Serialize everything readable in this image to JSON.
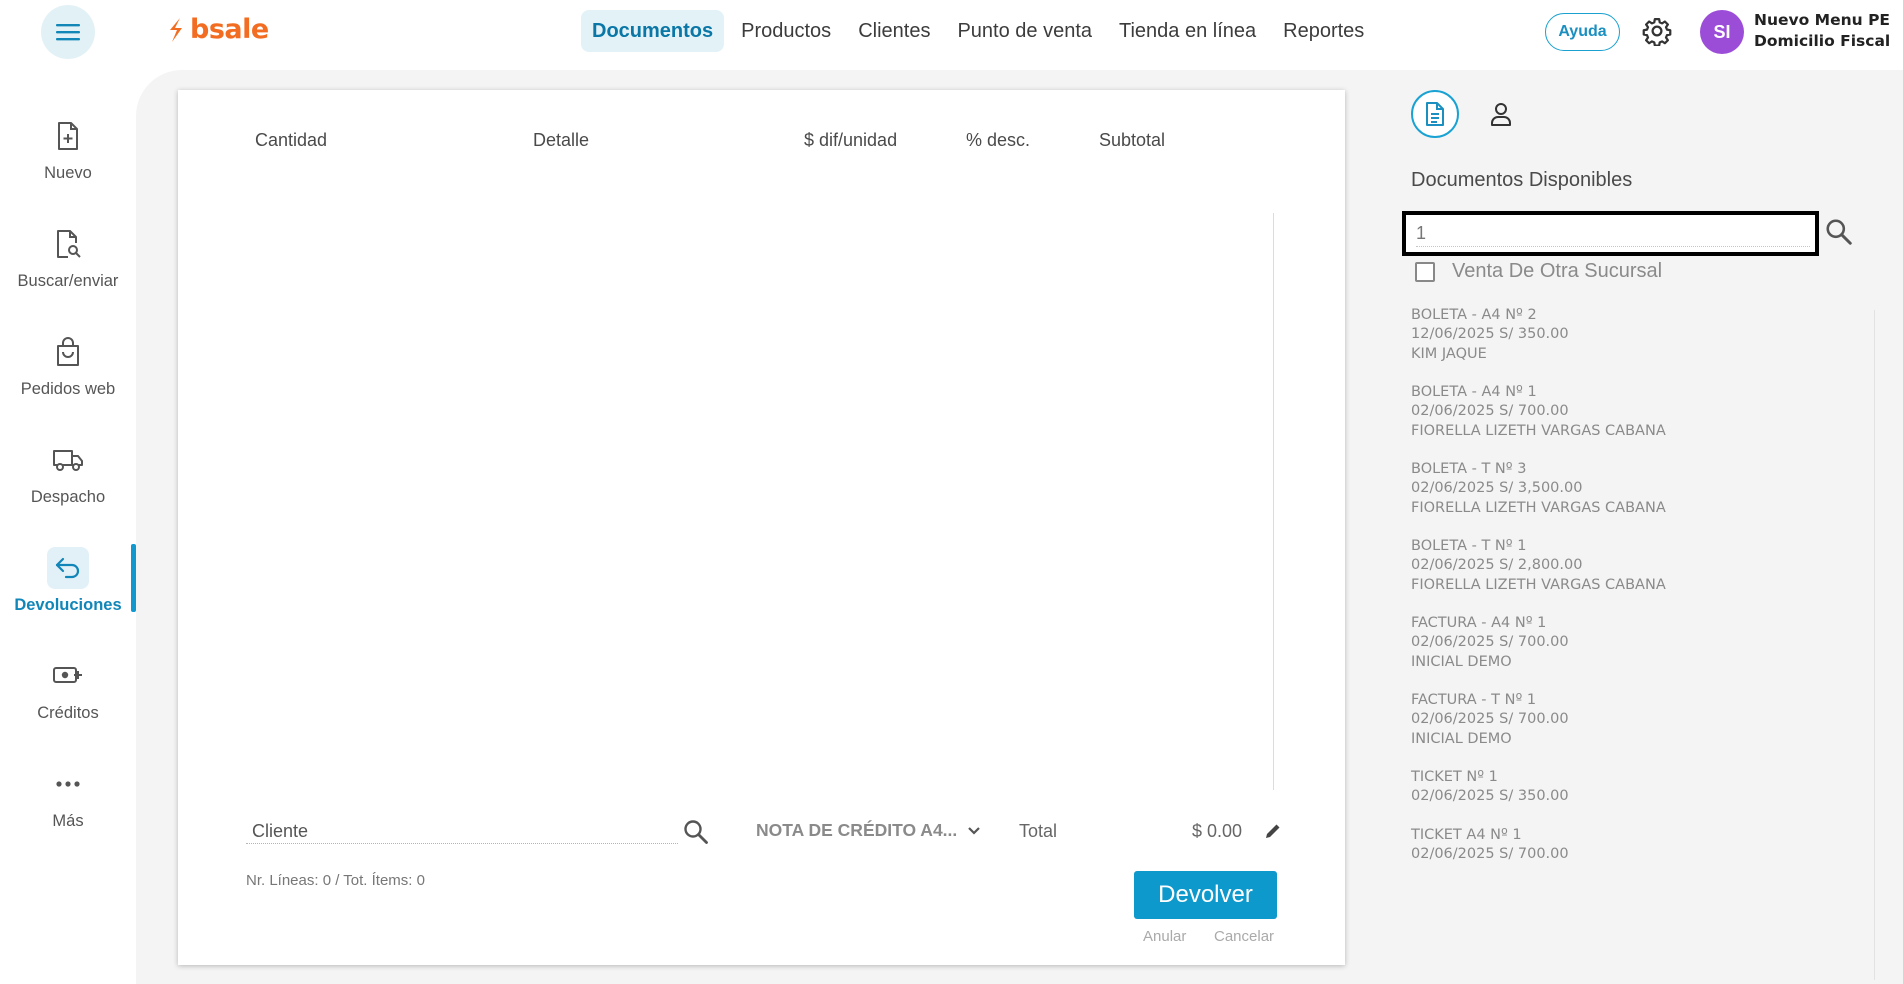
{
  "header": {
    "logo_text": "bsale",
    "nav": [
      {
        "label": "Documentos",
        "active": true
      },
      {
        "label": "Productos"
      },
      {
        "label": "Clientes"
      },
      {
        "label": "Punto de venta"
      },
      {
        "label": "Tienda en línea"
      },
      {
        "label": "Reportes"
      }
    ],
    "help_label": "Ayuda",
    "avatar_initials": "SI",
    "user_line1": "Nuevo Menu PE",
    "user_line2": "Domicilio Fiscal"
  },
  "sidebar": {
    "items": [
      {
        "label": "Nuevo",
        "icon": "file-plus-icon"
      },
      {
        "label": "Buscar/enviar",
        "icon": "file-search-icon"
      },
      {
        "label": "Pedidos web",
        "icon": "shopping-bag-icon"
      },
      {
        "label": "Despacho",
        "icon": "truck-icon"
      },
      {
        "label": "Devoluciones",
        "icon": "return-arrow-icon",
        "active": true
      },
      {
        "label": "Créditos",
        "icon": "money-plus-icon"
      },
      {
        "label": "Más",
        "icon": "more-dots-icon"
      }
    ]
  },
  "document": {
    "columns": [
      "Cantidad",
      "Detalle",
      "$ dif/unidad",
      "% desc.",
      "Subtotal"
    ],
    "client_placeholder": "Cliente",
    "doc_type": "NOTA DE CRÉDITO A4...",
    "total_label": "Total",
    "total_value": "$ 0.00",
    "lines_info": "Nr. Líneas: 0 / Tot. Ítems: 0",
    "devolver_label": "Devolver",
    "anular_label": "Anular",
    "cancelar_label": "Cancelar"
  },
  "right_panel": {
    "title": "Documentos Disponibles",
    "search_value": "1",
    "checkbox_label": "Venta De Otra Sucursal",
    "documents": [
      {
        "line1": "BOLETA - A4 Nº 2",
        "line2": "12/06/2025 S/ 350.00",
        "line3": "KIM JAQUE"
      },
      {
        "line1": "BOLETA - A4 Nº 1",
        "line2": "02/06/2025 S/ 700.00",
        "line3": "FIORELLA LIZETH VARGAS CABANA"
      },
      {
        "line1": "BOLETA - T Nº 3",
        "line2": "02/06/2025 S/ 3,500.00",
        "line3": "FIORELLA LIZETH VARGAS CABANA"
      },
      {
        "line1": "BOLETA - T Nº 1",
        "line2": "02/06/2025 S/ 2,800.00",
        "line3": "FIORELLA LIZETH VARGAS CABANA"
      },
      {
        "line1": "FACTURA - A4 Nº 1",
        "line2": "02/06/2025 S/ 700.00",
        "line3": "INICIAL DEMO"
      },
      {
        "line1": "FACTURA - T Nº 1",
        "line2": "02/06/2025 S/ 700.00",
        "line3": "INICIAL DEMO"
      },
      {
        "line1": "TICKET Nº 1",
        "line2": "02/06/2025 S/ 350.00",
        "line3": ""
      },
      {
        "line1": "TICKET A4 Nº 1",
        "line2": "02/06/2025 S/ 700.00",
        "line3": ""
      }
    ]
  },
  "colors": {
    "brand_orange": "#f26d21",
    "accent_blue": "#0e99cc",
    "avatar_purple": "#9c4dd8"
  }
}
